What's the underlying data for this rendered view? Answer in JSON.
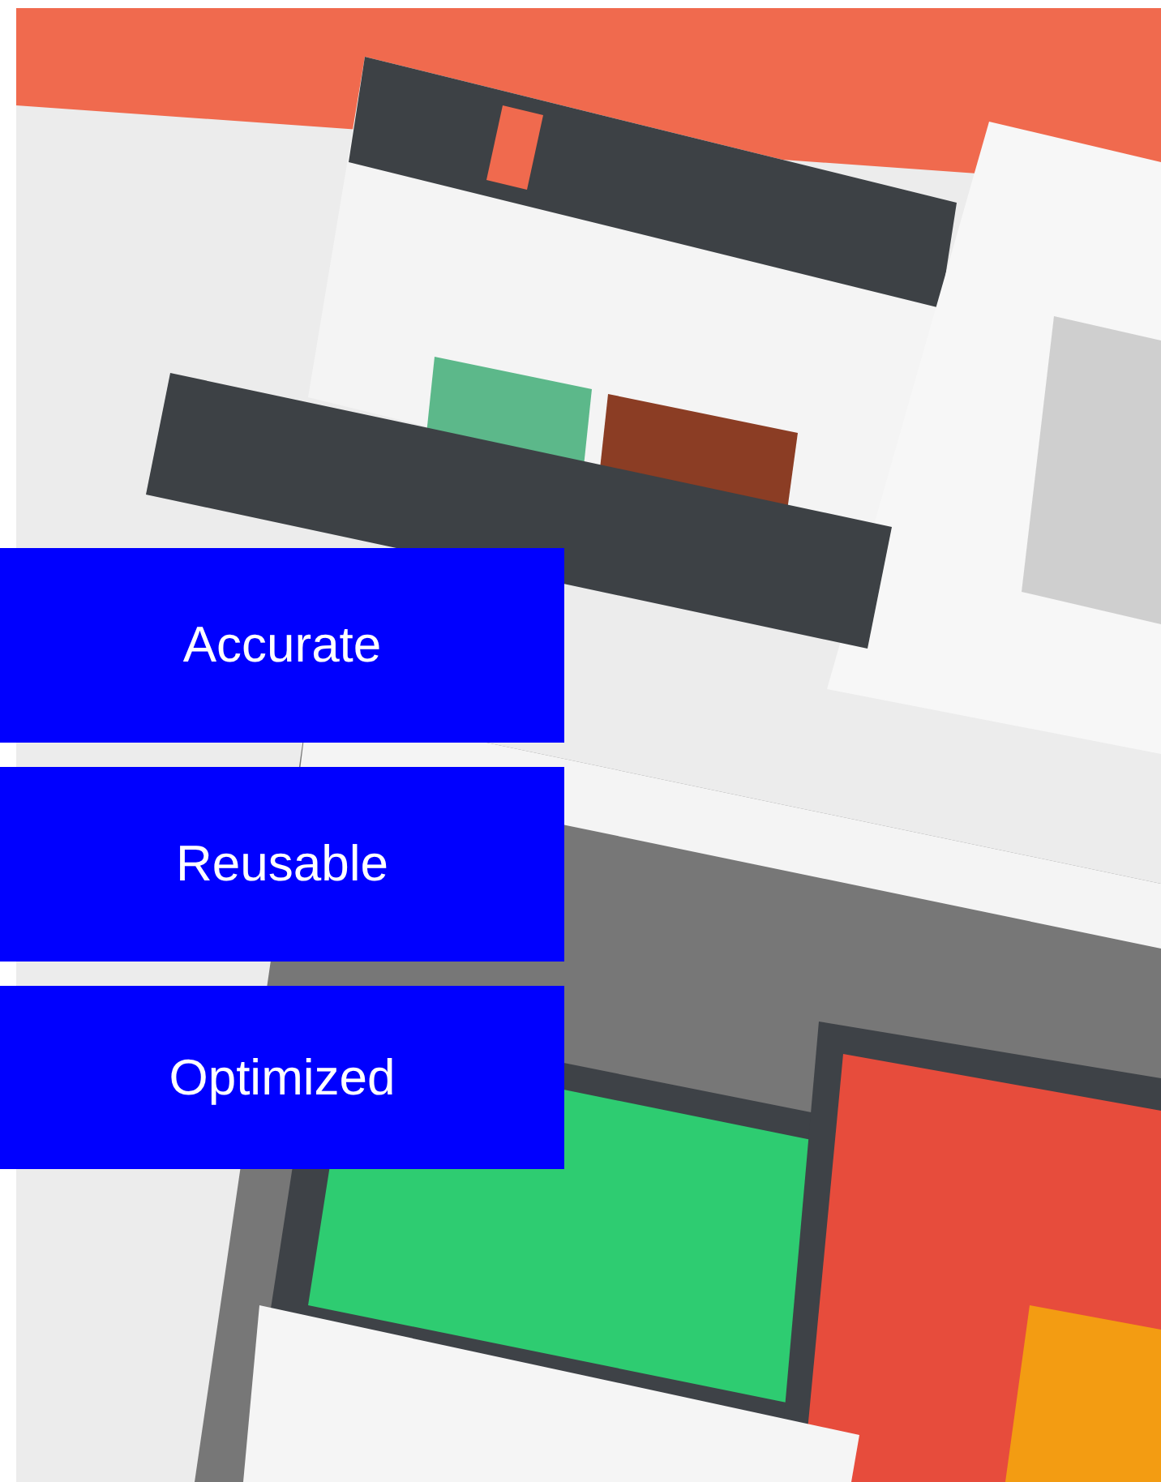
{
  "features": [
    {
      "label": "Accurate"
    },
    {
      "label": "Reusable"
    },
    {
      "label": "Optimized"
    }
  ]
}
